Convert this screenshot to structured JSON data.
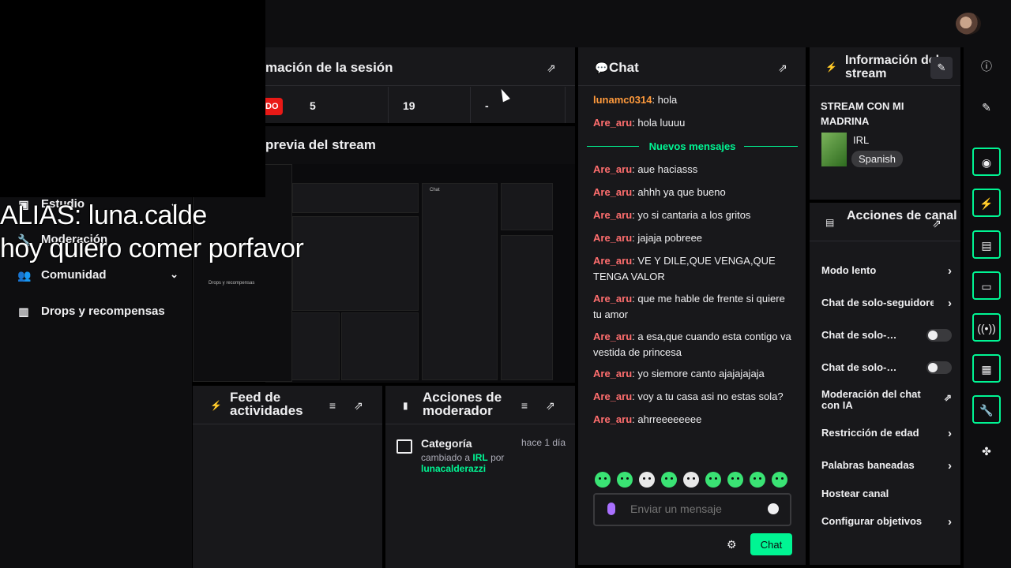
{
  "overlay": {
    "line1": "ALIAS: luna.calde",
    "line2": "hoy quiero comer porfavor"
  },
  "sidebar": {
    "items": [
      {
        "label": "Estudio",
        "icon": "studio-icon"
      },
      {
        "label": "Moderación",
        "icon": "wrench-icon"
      },
      {
        "label": "Comunidad",
        "icon": "community-icon"
      },
      {
        "label": "Drops y recompensas",
        "icon": "drops-icon"
      }
    ]
  },
  "session": {
    "title": "mación de la sesión",
    "live": "DO",
    "stats": [
      "5",
      "19",
      "-"
    ]
  },
  "preview": {
    "title": "previa del stream"
  },
  "feed": {
    "title": "Feed de actividades"
  },
  "mod_actions": {
    "title": "Acciones de moderador",
    "entry_title": "Categoría",
    "entry_time": "hace 1 día",
    "entry_prefix": "cambiado a",
    "entry_category": "IRL",
    "entry_by": "por",
    "entry_user": "lunacalderazzi"
  },
  "chat": {
    "title": "Chat",
    "messages_before": [
      {
        "user": "lunamc0314",
        "color": "#ff9a3c",
        "text": ": hola"
      },
      {
        "user": "Are_aru",
        "color": "#ff6e6e",
        "text": ": hola luuuu"
      }
    ],
    "new_messages_label": "Nuevos mensajes",
    "messages_after": [
      {
        "user": "Are_aru",
        "text": ": aue haciasss"
      },
      {
        "user": "Are_aru",
        "text": ": ahhh ya que bueno"
      },
      {
        "user": "Are_aru",
        "text": ": yo si cantaria a los gritos"
      },
      {
        "user": "Are_aru",
        "text": ": jajaja pobreee"
      },
      {
        "user": "Are_aru",
        "text": ": VE Y DILE,QUE VENGA,QUE TENGA VALOR"
      },
      {
        "user": "Are_aru",
        "text": ": que me hable de frente si quiere tu amor"
      },
      {
        "user": "Are_aru",
        "text": ": a esa,que cuando esta contigo va vestida de princesa"
      },
      {
        "user": "Are_aru",
        "text": ": yo siemore canto ajajajajaja"
      },
      {
        "user": "Are_aru",
        "text": ": voy a tu casa asi no estas sola?"
      },
      {
        "user": "Are_aru",
        "text": ": ahrreeeeeeee"
      }
    ],
    "input_placeholder": "Enviar un mensaje",
    "send_label": "Chat"
  },
  "stream_info": {
    "title": "Información del stream",
    "stream_title": "STREAM CON MI MADRINA",
    "category": "IRL",
    "tag": "Spanish"
  },
  "channel_actions": {
    "title": "Acciones de canal",
    "items": [
      {
        "label": "Modo lento",
        "control": "chevron"
      },
      {
        "label": "Chat de solo-seguidores",
        "control": "chevron"
      },
      {
        "label": "Chat de solo-…",
        "control": "toggle"
      },
      {
        "label": "Chat de solo-…",
        "control": "toggle"
      },
      {
        "label": "Moderación del chat con IA",
        "control": "external"
      },
      {
        "label": "Restricción de edad",
        "control": "chevron"
      },
      {
        "label": "Palabras baneadas",
        "control": "chevron"
      },
      {
        "label": "Hostear canal",
        "control": "none"
      },
      {
        "label": "Configurar objetivos",
        "control": "chevron"
      }
    ]
  },
  "colors": {
    "accent": "#00f593",
    "username": "#ff6e6e",
    "live": "#e91916"
  }
}
